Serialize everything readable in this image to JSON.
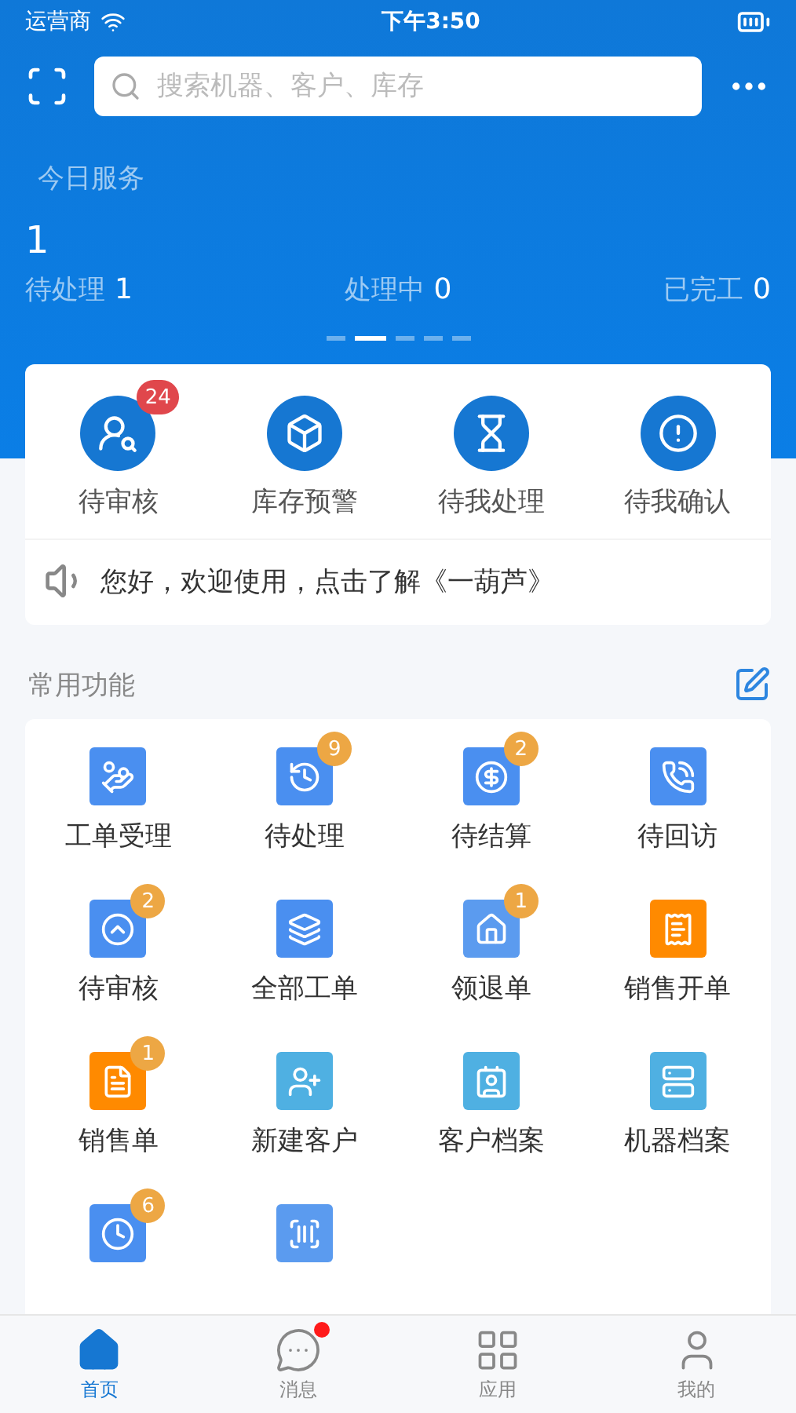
{
  "status_bar": {
    "carrier": "运营商",
    "time": "下午3:50"
  },
  "search": {
    "placeholder": "搜索机器、客户、库存"
  },
  "today": {
    "title": "今日服务",
    "total": "1",
    "stats": [
      {
        "label": "待处理",
        "value": "1"
      },
      {
        "label": "处理中",
        "value": "0"
      },
      {
        "label": "已完工",
        "value": "0"
      }
    ],
    "pages": [
      {
        "selected": false
      },
      {
        "selected": true
      },
      {
        "selected": false
      },
      {
        "selected": false
      },
      {
        "selected": false
      }
    ]
  },
  "quick": [
    {
      "label": "待审核",
      "badge": "24"
    },
    {
      "label": "库存预警"
    },
    {
      "label": "待我处理"
    },
    {
      "label": "待我确认"
    }
  ],
  "notice": "您好，欢迎使用，点击了解《一葫芦》",
  "section": {
    "title": "常用功能"
  },
  "functions": [
    {
      "label": "工单受理",
      "color": "#4a8ff0"
    },
    {
      "label": "待处理",
      "color": "#4a8ff0",
      "badge": "9"
    },
    {
      "label": "待结算",
      "color": "#4a8ff0",
      "badge": "2"
    },
    {
      "label": "待回访",
      "color": "#4a8ff0"
    },
    {
      "label": "待审核",
      "color": "#4a8ff0",
      "badge": "2"
    },
    {
      "label": "全部工单",
      "color": "#4a8ff0"
    },
    {
      "label": "领退单",
      "color": "#5b9bef",
      "badge": "1"
    },
    {
      "label": "销售开单",
      "color": "#ff8a00"
    },
    {
      "label": "销售单",
      "color": "#ff8a00",
      "badge": "1"
    },
    {
      "label": "新建客户",
      "color": "#4fb0e2"
    },
    {
      "label": "客户档案",
      "color": "#4fb0e2"
    },
    {
      "label": "机器档案",
      "color": "#4fb0e2"
    },
    {
      "color": "#4a8ff0",
      "badge": "6"
    },
    {
      "color": "#5b9bef"
    }
  ],
  "tabs": [
    {
      "label": "首页",
      "selected": true,
      "dot": false
    },
    {
      "label": "消息",
      "selected": false,
      "dot": true
    },
    {
      "label": "应用",
      "selected": false,
      "dot": false
    },
    {
      "label": "我的",
      "selected": false,
      "dot": false
    }
  ]
}
